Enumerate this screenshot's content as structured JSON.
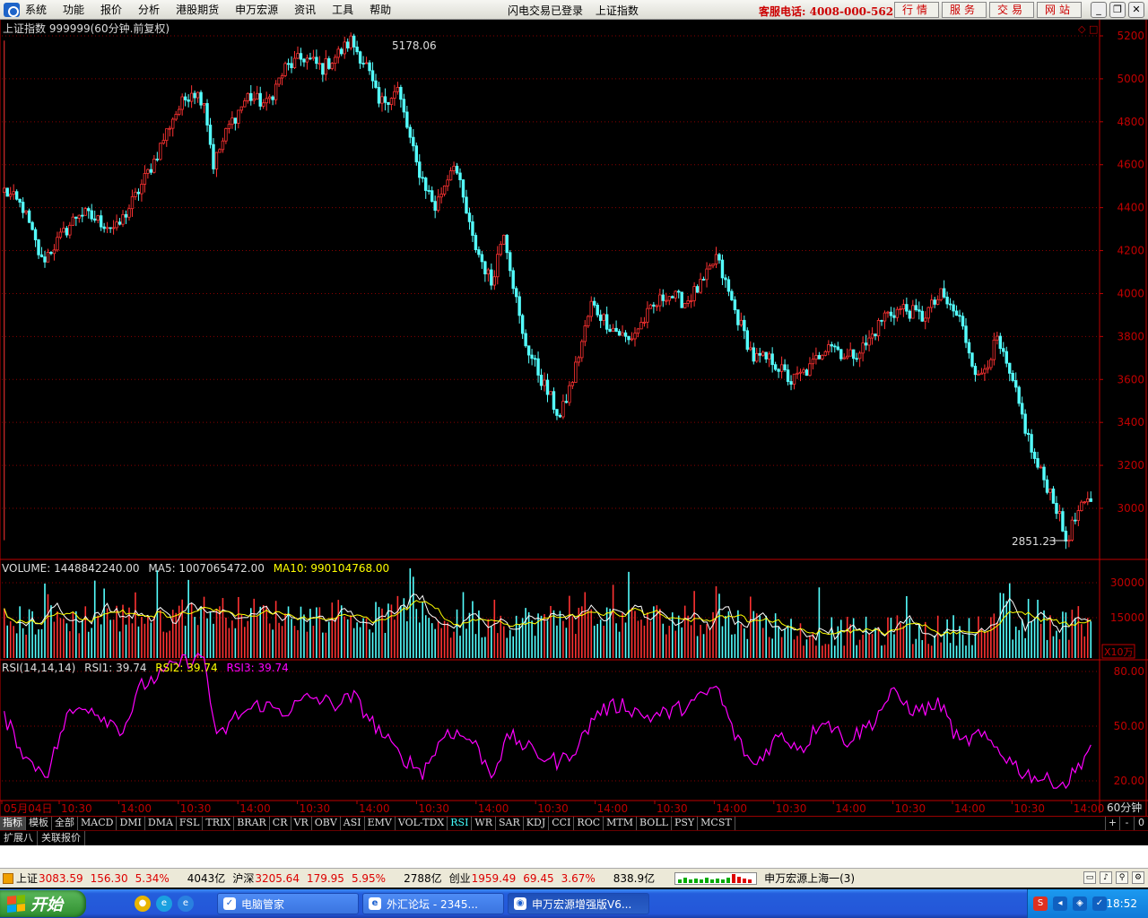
{
  "menubar": {
    "items": [
      "系统",
      "功能",
      "报价",
      "分析",
      "港股期货",
      "申万宏源",
      "资讯",
      "工具",
      "帮助"
    ],
    "login_status": "闪电交易已登录",
    "current_security": "上证指数",
    "hotline": "客服电话: 4008-000-562",
    "quick_buttons": [
      "行情",
      "服务",
      "交易",
      "网站"
    ]
  },
  "main_chart": {
    "title": "上证指数 999999(60分钟.前复权)",
    "high_label": "5178.06",
    "low_label": "2851.23"
  },
  "volume_panel": {
    "label": "VOLUME: 1448842240.00",
    "ma5_label": "MA5: 1007065472.00",
    "ma10_label": "MA10: 990104768.00",
    "unit_label": "X10万"
  },
  "rsi_panel": {
    "label": "RSI(14,14,14)",
    "rsi1_label": "RSI1: 39.74",
    "rsi2_label": "RSI2: 39.74",
    "rsi3_label": "RSI3: 39.74"
  },
  "period_label": "60分钟",
  "colors": {
    "up": "#ff3232",
    "down": "#54ffff",
    "grid": "#8a0000",
    "axis": "#c00000",
    "ma5": "#ffffff",
    "ma10": "#ffff00",
    "rsi": "#ff00ff"
  },
  "chart_data": [
    {
      "type": "candlestick",
      "title": "上证指数 999999(60分钟.前复权)",
      "ylim": [
        2851,
        5220
      ],
      "y_ticks": [
        "5200",
        "5000",
        "4800",
        "4600",
        "4400",
        "4200",
        "4000",
        "3800",
        "3600",
        "3400",
        "3200",
        "3000"
      ],
      "x_tick_labels": [
        "05月04日",
        "10:30",
        "14:00",
        "10:30",
        "14:00",
        "10:30",
        "14:00",
        "10:30",
        "14:00",
        "10:30",
        "14:00",
        "10:30",
        "14:00",
        "10:30",
        "14:00",
        "10:30",
        "14:00",
        "10:30",
        "14:00"
      ],
      "anchors": [
        [
          0,
          4480
        ],
        [
          6,
          4400
        ],
        [
          12,
          4150
        ],
        [
          18,
          4260
        ],
        [
          24,
          4380
        ],
        [
          30,
          4340
        ],
        [
          36,
          4300
        ],
        [
          42,
          4450
        ],
        [
          48,
          4620
        ],
        [
          54,
          4820
        ],
        [
          60,
          4950
        ],
        [
          64,
          4900
        ],
        [
          67,
          4600
        ],
        [
          72,
          4780
        ],
        [
          78,
          4920
        ],
        [
          84,
          4880
        ],
        [
          90,
          5050
        ],
        [
          96,
          5100
        ],
        [
          102,
          5050
        ],
        [
          108,
          5130
        ],
        [
          111,
          5178
        ],
        [
          116,
          5060
        ],
        [
          120,
          4880
        ],
        [
          126,
          4950
        ],
        [
          132,
          4600
        ],
        [
          138,
          4400
        ],
        [
          144,
          4620
        ],
        [
          150,
          4250
        ],
        [
          156,
          4050
        ],
        [
          160,
          4300
        ],
        [
          166,
          3800
        ],
        [
          172,
          3600
        ],
        [
          178,
          3420
        ],
        [
          182,
          3600
        ],
        [
          188,
          3950
        ],
        [
          194,
          3850
        ],
        [
          200,
          3780
        ],
        [
          206,
          3900
        ],
        [
          212,
          4000
        ],
        [
          218,
          3960
        ],
        [
          224,
          4050
        ],
        [
          228,
          4170
        ],
        [
          234,
          3920
        ],
        [
          240,
          3700
        ],
        [
          246,
          3690
        ],
        [
          252,
          3590
        ],
        [
          258,
          3650
        ],
        [
          264,
          3780
        ],
        [
          270,
          3700
        ],
        [
          276,
          3760
        ],
        [
          282,
          3900
        ],
        [
          288,
          3930
        ],
        [
          294,
          3890
        ],
        [
          300,
          3990
        ],
        [
          306,
          3880
        ],
        [
          312,
          3600
        ],
        [
          318,
          3780
        ],
        [
          324,
          3530
        ],
        [
          330,
          3220
        ],
        [
          336,
          3050
        ],
        [
          340,
          2851
        ],
        [
          344,
          2980
        ],
        [
          348,
          3040
        ]
      ],
      "high": 5178.06,
      "low": 2851.23
    },
    {
      "type": "bar",
      "title": "VOLUME",
      "y_ticks": [
        "30000",
        "15000"
      ],
      "last": 1448842240.0,
      "ma5_last": 1007065472.0,
      "ma10_last": 990104768.0
    },
    {
      "type": "line",
      "title": "RSI(14,14,14)",
      "y_ticks": [
        "80.00",
        "50.00",
        "20.00"
      ],
      "ylim": [
        15,
        90
      ],
      "anchors": [
        [
          0,
          55
        ],
        [
          8,
          30
        ],
        [
          14,
          25
        ],
        [
          20,
          55
        ],
        [
          26,
          62
        ],
        [
          32,
          55
        ],
        [
          38,
          48
        ],
        [
          44,
          72
        ],
        [
          50,
          78
        ],
        [
          56,
          85
        ],
        [
          64,
          88
        ],
        [
          68,
          42
        ],
        [
          74,
          55
        ],
        [
          82,
          62
        ],
        [
          90,
          58
        ],
        [
          98,
          66
        ],
        [
          106,
          62
        ],
        [
          112,
          66
        ],
        [
          118,
          52
        ],
        [
          126,
          35
        ],
        [
          134,
          25
        ],
        [
          142,
          48
        ],
        [
          150,
          42
        ],
        [
          156,
          24
        ],
        [
          162,
          45
        ],
        [
          170,
          35
        ],
        [
          178,
          30
        ],
        [
          184,
          40
        ],
        [
          190,
          58
        ],
        [
          198,
          62
        ],
        [
          206,
          55
        ],
        [
          214,
          58
        ],
        [
          222,
          64
        ],
        [
          228,
          72
        ],
        [
          234,
          45
        ],
        [
          240,
          28
        ],
        [
          248,
          45
        ],
        [
          256,
          38
        ],
        [
          262,
          55
        ],
        [
          270,
          42
        ],
        [
          278,
          52
        ],
        [
          284,
          68
        ],
        [
          292,
          58
        ],
        [
          300,
          62
        ],
        [
          306,
          40
        ],
        [
          312,
          45
        ],
        [
          318,
          38
        ],
        [
          326,
          25
        ],
        [
          334,
          20
        ],
        [
          340,
          18
        ],
        [
          344,
          28
        ],
        [
          348,
          39.74
        ]
      ],
      "rsi1": 39.74,
      "rsi2": 39.74,
      "rsi3": 39.74
    }
  ],
  "indicator_tabs": [
    "指标",
    "模板",
    "全部",
    "MACD",
    "DMI",
    "DMA",
    "FSL",
    "TRIX",
    "BRAR",
    "CR",
    "VR",
    "OBV",
    "ASI",
    "EMV",
    "VOL-TDX",
    "RSI",
    "WR",
    "SAR",
    "KDJ",
    "CCI",
    "ROC",
    "MTM",
    "BOLL",
    "PSY",
    "MCST"
  ],
  "tab_right": [
    "+",
    "-",
    "0"
  ],
  "sub_tabs": [
    "扩展八",
    "关联报价"
  ],
  "statusbar": {
    "sh_label": "上证",
    "sh_value": "3083.59",
    "sh_change": "156.30",
    "sh_pct": "5.34%",
    "sh_amount": "4043亿",
    "hs_label": "沪深",
    "hs_value": "3205.64",
    "hs_change": "179.95",
    "hs_pct": "5.95%",
    "hs_amount": "2788亿",
    "cy_label": "创业",
    "cy_value": "1959.49",
    "cy_change": "69.45",
    "cy_pct": "3.67%",
    "cy_amount": "838.9亿",
    "source": "申万宏源上海一(3)"
  },
  "taskbar": {
    "start": "开始",
    "items": [
      "电脑管家",
      "外汇论坛 - 2345...",
      "申万宏源增强版V6..."
    ],
    "clock": "18:52"
  }
}
